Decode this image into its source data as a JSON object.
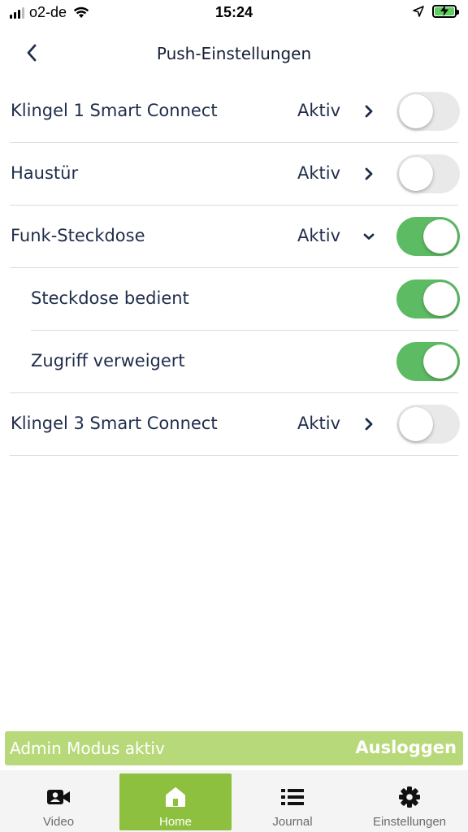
{
  "status_bar": {
    "carrier": "o2-de",
    "time": "15:24"
  },
  "header": {
    "title": "Push-Einstellungen"
  },
  "settings": {
    "rows": [
      {
        "label": "Klingel 1 Smart Connect",
        "status": "Aktiv",
        "chevron": "chevron-right",
        "enabled": false,
        "level": "top"
      },
      {
        "label": "Haustür",
        "status": "Aktiv",
        "chevron": "chevron-right",
        "enabled": false,
        "level": "top"
      },
      {
        "label": "Funk-Steckdose",
        "status": "Aktiv",
        "chevron": "chevron-down",
        "enabled": true,
        "level": "top"
      },
      {
        "label": "Steckdose bedient",
        "enabled": true,
        "level": "sub"
      },
      {
        "label": "Zugriff verweigert",
        "enabled": true,
        "level": "sub"
      },
      {
        "label": "Klingel 3 Smart Connect",
        "status": "Aktiv",
        "chevron": "chevron-right",
        "enabled": false,
        "level": "top"
      }
    ]
  },
  "admin": {
    "label": "Admin Modus aktiv",
    "logout_label": "Ausloggen"
  },
  "tabs": [
    {
      "label": "Video",
      "icon": "video-camera-icon",
      "active": false
    },
    {
      "label": "Home",
      "icon": "home-icon",
      "active": true
    },
    {
      "label": "Journal",
      "icon": "list-icon",
      "active": false
    },
    {
      "label": "Einstellungen",
      "icon": "gear-icon",
      "active": false
    }
  ],
  "colors": {
    "toggle_on": "#5dbb63",
    "toggle_off": "#e9e9ea",
    "admin_bar": "#b8d97a",
    "active_tab": "#8dc03f",
    "text": "#1f2d4a"
  }
}
